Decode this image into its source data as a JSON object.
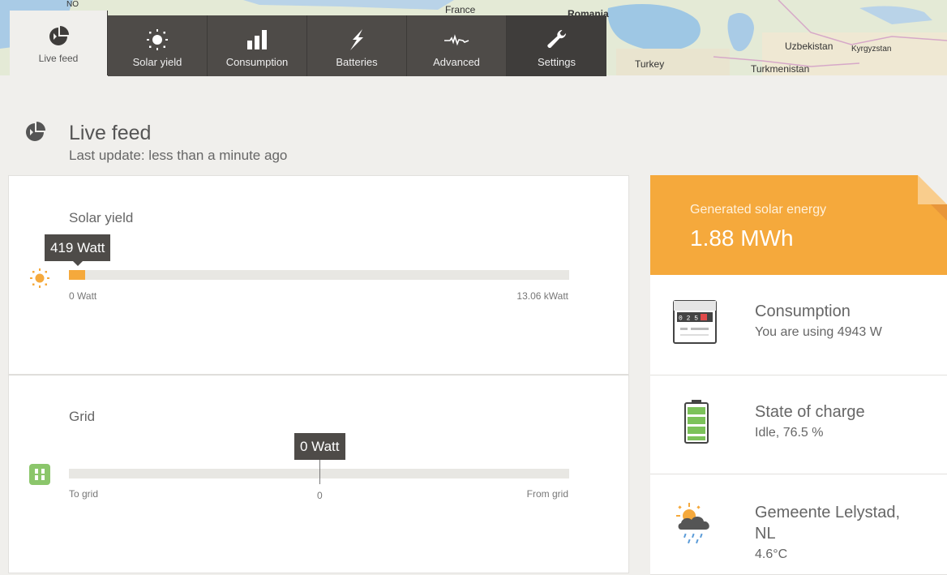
{
  "map": {
    "labels": [
      "France",
      "Romania",
      "Turkey",
      "Uzbekistan",
      "Kyrgyzstan",
      "Turkmenistan",
      "NO"
    ]
  },
  "nav": {
    "tabs": [
      {
        "label": "Live feed",
        "icon": "pie-icon",
        "active": true
      },
      {
        "label": "Solar yield",
        "icon": "sun-icon",
        "active": false
      },
      {
        "label": "Consumption",
        "icon": "bar-chart-icon",
        "active": false
      },
      {
        "label": "Batteries",
        "icon": "lightning-icon",
        "active": false
      },
      {
        "label": "Advanced",
        "icon": "waveform-icon",
        "active": false
      },
      {
        "label": "Settings",
        "icon": "wrench-icon",
        "active": false
      }
    ]
  },
  "page": {
    "title": "Live feed",
    "subtitle": "Last update: less than a minute ago"
  },
  "solar": {
    "title": "Solar yield",
    "value_label": "419 Watt",
    "value_w": 419,
    "max_w": 13060,
    "min_label": "0 Watt",
    "max_label": "13.06 kWatt"
  },
  "grid": {
    "title": "Grid",
    "value_label": "0 Watt",
    "left_label": "To grid",
    "center_label": "0",
    "right_label": "From grid",
    "position_fraction": 0.5
  },
  "generated": {
    "label": "Generated solar energy",
    "value": "1.88 MWh"
  },
  "cards": {
    "consumption": {
      "title": "Consumption",
      "sub": "You are using 4943 W"
    },
    "charge": {
      "title": "State of charge",
      "sub": "Idle, 76.5 %"
    },
    "weather": {
      "title": "Gemeente Lelystad,",
      "title2": "NL",
      "sub": "4.6°C"
    }
  },
  "meter_digits": "0 2 5",
  "colors": {
    "accent": "#f5a93c",
    "nav_bg": "#4e4b48",
    "battery_green": "#7cc25a",
    "grid_green": "#8bc66b"
  }
}
